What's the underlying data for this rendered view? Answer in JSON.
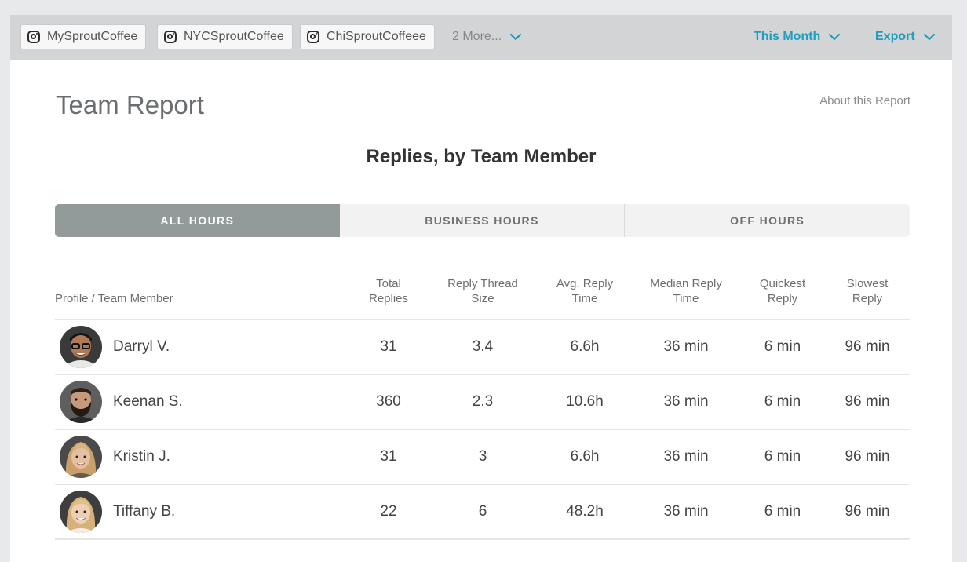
{
  "toolbar": {
    "profiles": [
      {
        "name": "MySproutCoffee",
        "icon": "instagram-icon"
      },
      {
        "name": "NYCSproutCoffee",
        "icon": "instagram-icon"
      },
      {
        "name": "ChiSproutCoffeee",
        "icon": "instagram-icon"
      }
    ],
    "more_label": "2 More...",
    "date_range_label": "This Month",
    "export_label": "Export",
    "accent_color": "#1e9dbd"
  },
  "report": {
    "title": "Team Report",
    "about_link": "About this Report",
    "section_title": "Replies, by Team Member"
  },
  "tabs": [
    {
      "label": "ALL HOURS",
      "active": true
    },
    {
      "label": "BUSINESS HOURS",
      "active": false
    },
    {
      "label": "OFF HOURS",
      "active": false
    }
  ],
  "table": {
    "headers": {
      "member": "Profile / Team Member",
      "total_replies": [
        "Total",
        "Replies"
      ],
      "thread_size": [
        "Reply Thread",
        "Size"
      ],
      "avg_time": [
        "Avg. Reply",
        "Time"
      ],
      "median_time": [
        "Median Reply",
        "Time"
      ],
      "quickest": [
        "Quickest",
        "Reply"
      ],
      "slowest": [
        "Slowest",
        "Reply"
      ]
    },
    "rows": [
      {
        "name": "Darryl V.",
        "total_replies": "31",
        "thread_size": "3.4",
        "avg_time": "6.6h",
        "median_time": "36 min",
        "quickest": "6 min",
        "slowest": "96 min"
      },
      {
        "name": "Keenan S.",
        "total_replies": "360",
        "thread_size": "2.3",
        "avg_time": "10.6h",
        "median_time": "36 min",
        "quickest": "6 min",
        "slowest": "96 min"
      },
      {
        "name": "Kristin J.",
        "total_replies": "31",
        "thread_size": "3",
        "avg_time": "6.6h",
        "median_time": "36 min",
        "quickest": "6 min",
        "slowest": "96 min"
      },
      {
        "name": "Tiffany B.",
        "total_replies": "22",
        "thread_size": "6",
        "avg_time": "48.2h",
        "median_time": "36 min",
        "quickest": "6 min",
        "slowest": "96 min"
      }
    ]
  }
}
